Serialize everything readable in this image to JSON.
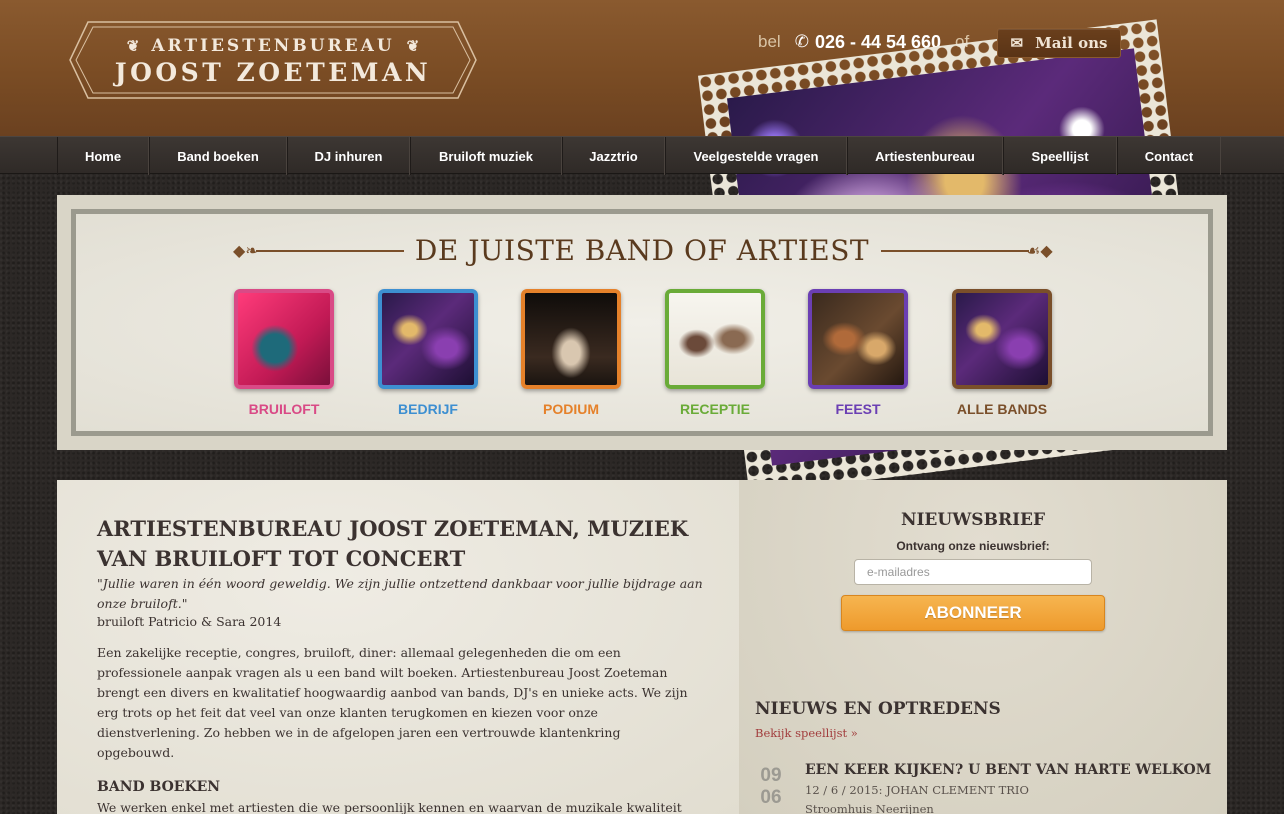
{
  "logo": {
    "top_text": "ARTIESTENBUREAU",
    "bottom_text": "JOOST ZOETEMAN",
    "ornament_left": "❦",
    "ornament_right": "❦"
  },
  "contact": {
    "bel_label": "bel",
    "phone_icon": "phone-icon",
    "phone_number": "026 - 44 54 660",
    "of_label": "of",
    "mail_icon": "envelope-icon",
    "mail_button_label": "Mail ons"
  },
  "nav": {
    "items": [
      {
        "label": "Home"
      },
      {
        "label": "Band boeken"
      },
      {
        "label": "DJ inhuren"
      },
      {
        "label": "Bruiloft muziek"
      },
      {
        "label": "Jazztrio"
      },
      {
        "label": "Veelgestelde vragen"
      },
      {
        "label": "Artiestenbureau"
      },
      {
        "label": "Speellijst"
      },
      {
        "label": "Contact"
      }
    ]
  },
  "categories": {
    "title": "DE JUISTE BAND OF ARTIEST",
    "items": [
      {
        "label": "BRUILOFT",
        "color": "#d94a86"
      },
      {
        "label": "BEDRIJF",
        "color": "#3d8fd1"
      },
      {
        "label": "PODIUM",
        "color": "#e5812a"
      },
      {
        "label": "RECEPTIE",
        "color": "#6aab38"
      },
      {
        "label": "FEEST",
        "color": "#6b3fb3"
      },
      {
        "label": "ALLE BANDS",
        "color": "#7a4f2a"
      }
    ]
  },
  "main": {
    "title": "ARTIESTENBUREAU JOOST ZOETEMAN, MUZIEK VAN BRUILOFT TOT CONCERT",
    "quote": "\"Jullie waren in één woord geweldig. We zijn jullie ontzettend dankbaar voor jullie bijdrage aan onze bruiloft.\"",
    "quote_by": "bruiloft Patricio & Sara 2014",
    "intro": "Een zakelijke receptie, congres, bruiloft, diner: allemaal gelegenheden die om een professionele aanpak vragen als u een band wilt boeken. Artiestenbureau Joost Zoeteman brengt een divers en kwalitatief hoogwaardig aanbod van bands, DJ's en unieke acts. We zijn erg trots op het feit dat veel van onze klanten terugkomen en kiezen voor onze dienstverlening. Zo hebben we in de afgelopen jaren een vertrouwde klantenkring opgebouwd.",
    "band_title": "BAND BOEKEN",
    "band_text": "We werken enkel met artiesten die we persoonlijk kennen en waarvan de muzikale kwaliteit"
  },
  "newsletter": {
    "title": "NIEUWSBRIEF",
    "subtitle": "Ontvang onze nieuwsbrief:",
    "placeholder": "e-mailadres",
    "button_label": "ABONNEER"
  },
  "news": {
    "title": "NIEUWS EN OPTREDENS",
    "link_label": "Bekijk speellijst »",
    "items": [
      {
        "day": "09",
        "month": "06",
        "title": "EEN KEER KIJKEN? U BENT VAN HARTE WELKOM",
        "meta": "12 / 6 / 2015:  JOHAN CLEMENT TRIO",
        "place": "Stroomhuis Neerijnen"
      }
    ]
  }
}
